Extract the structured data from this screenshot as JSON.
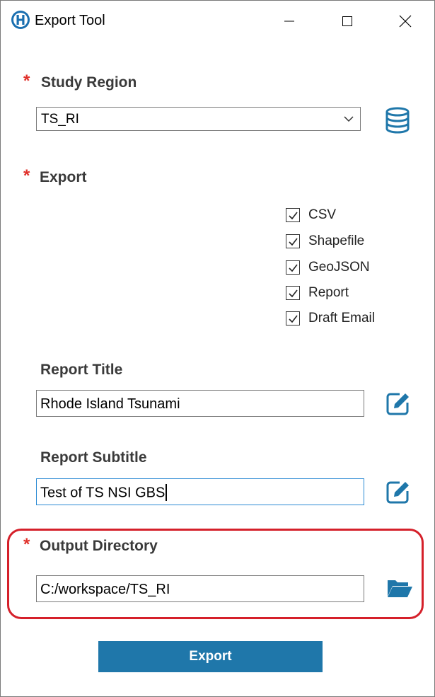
{
  "window": {
    "title": "Export Tool"
  },
  "study_region": {
    "label": "Study Region",
    "required_mark": "*",
    "selected": "TS_RI",
    "icon": "database-icon"
  },
  "export": {
    "label": "Export",
    "required_mark": "*",
    "options": [
      {
        "label": "CSV",
        "checked": true
      },
      {
        "label": "Shapefile",
        "checked": true
      },
      {
        "label": "GeoJSON",
        "checked": true
      },
      {
        "label": "Report",
        "checked": true
      },
      {
        "label": "Draft Email",
        "checked": true
      }
    ]
  },
  "report_title": {
    "label": "Report Title",
    "value": "Rhode Island Tsunami",
    "icon": "edit-icon"
  },
  "report_subtitle": {
    "label": "Report Subtitle",
    "value": "Test of TS NSI GBS",
    "icon": "edit-icon"
  },
  "output_directory": {
    "label": "Output Directory",
    "required_mark": "*",
    "value": "C:/workspace/TS_RI",
    "icon": "folder-open-icon"
  },
  "export_button": {
    "label": "Export"
  },
  "colors": {
    "accent": "#1f77aa",
    "required": "#e0302a",
    "highlight": "#d5202a",
    "focus": "#2a8ad4"
  }
}
